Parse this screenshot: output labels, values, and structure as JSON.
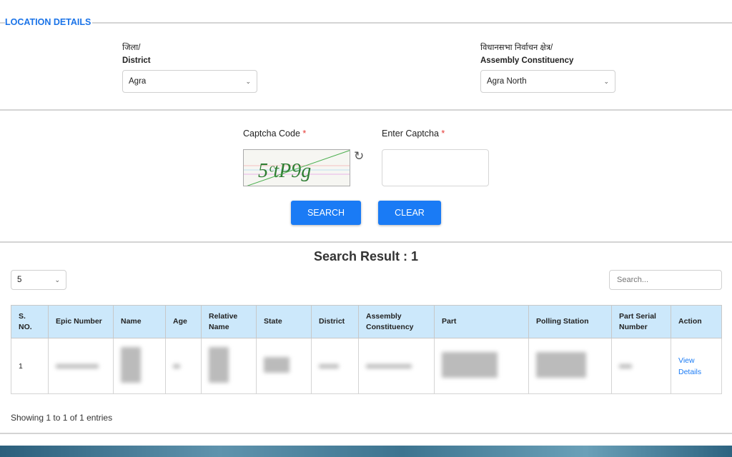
{
  "section_title": "LOCATION DETAILS",
  "district": {
    "label_hi": "जिला/",
    "label_en": "District",
    "value": "Agra"
  },
  "assembly": {
    "label_hi": "विधानसभा निर्वाचन क्षेत्र/",
    "label_en": "Assembly Constituency",
    "value": "Agra North"
  },
  "captcha": {
    "code_label": "Captcha Code",
    "enter_label": "Enter Captcha",
    "required_mark": "*",
    "image_text": "5ctP9g",
    "input_value": ""
  },
  "buttons": {
    "search": "SEARCH",
    "clear": "CLEAR"
  },
  "results": {
    "title": "Search Result : 1",
    "page_size": "5",
    "search_placeholder": "Search...",
    "info": "Showing 1 to 1 of 1 entries"
  },
  "table": {
    "headers": [
      "S. NO.",
      "Epic Number",
      "Name",
      "Age",
      "Relative Name",
      "State",
      "District",
      "Assembly Constituency",
      "Part",
      "Polling Station",
      "Part Serial Number",
      "Action"
    ],
    "rows": [
      {
        "sno": "1",
        "action": "View Details"
      }
    ]
  },
  "colors": {
    "accent": "#1a7bf5",
    "header_bg": "#cce8fb",
    "required": "#e53935"
  }
}
